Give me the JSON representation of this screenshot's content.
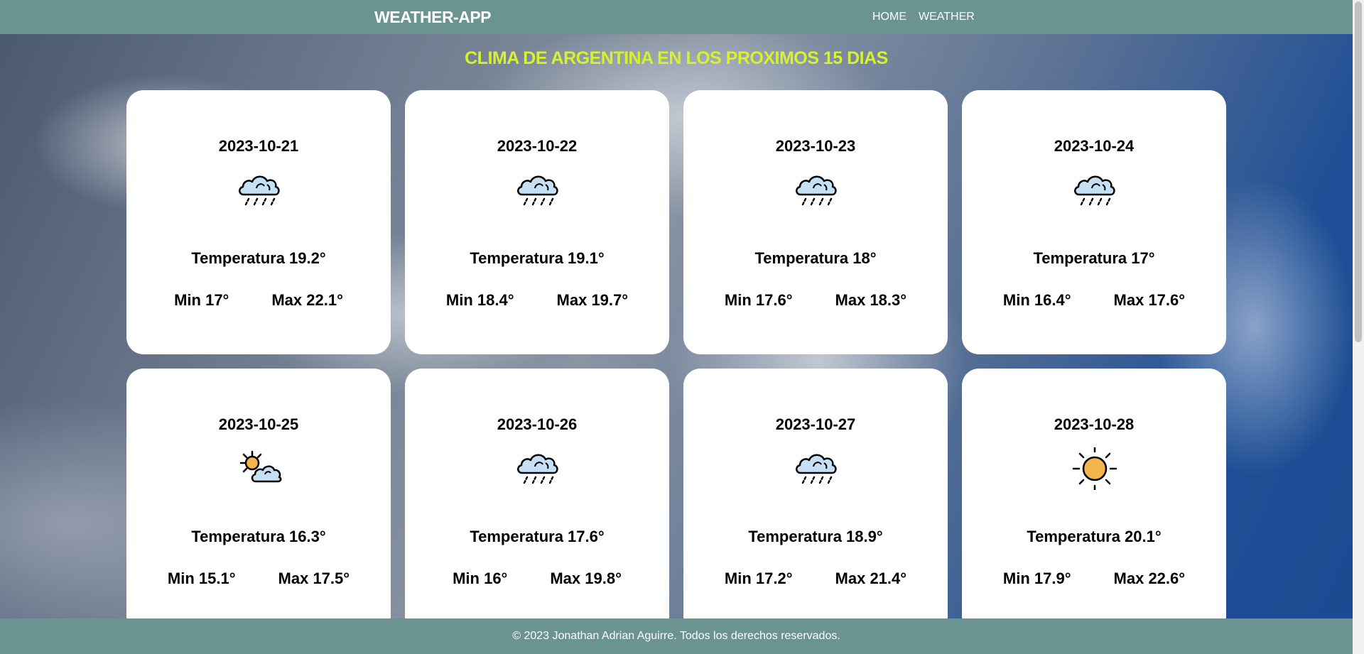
{
  "navbar": {
    "brand": "WEATHER-APP",
    "links": [
      {
        "label": "HOME"
      },
      {
        "label": "WEATHER"
      }
    ]
  },
  "heading": "CLIMA DE ARGENTINA EN LOS PROXIMOS 15 DIAS",
  "colors": {
    "navbar": "#6a9391",
    "heading": "#d6f22c",
    "card": "#ffffff",
    "sun": "#f4b54c",
    "cloud": "#c5e0f5"
  },
  "cards": [
    {
      "date": "2023-10-21",
      "icon": "rain-cloud-icon",
      "temp": "Temperatura 19.2°",
      "min": "Min 17°",
      "max": "Max 22.1°"
    },
    {
      "date": "2023-10-22",
      "icon": "rain-cloud-icon",
      "temp": "Temperatura 19.1°",
      "min": "Min 18.4°",
      "max": "Max 19.7°"
    },
    {
      "date": "2023-10-23",
      "icon": "rain-cloud-icon",
      "temp": "Temperatura 18°",
      "min": "Min 17.6°",
      "max": "Max 18.3°"
    },
    {
      "date": "2023-10-24",
      "icon": "rain-cloud-icon",
      "temp": "Temperatura 17°",
      "min": "Min 16.4°",
      "max": "Max 17.6°"
    },
    {
      "date": "2023-10-25",
      "icon": "partly-cloudy-icon",
      "temp": "Temperatura 16.3°",
      "min": "Min 15.1°",
      "max": "Max 17.5°"
    },
    {
      "date": "2023-10-26",
      "icon": "rain-cloud-icon",
      "temp": "Temperatura 17.6°",
      "min": "Min 16°",
      "max": "Max 19.8°"
    },
    {
      "date": "2023-10-27",
      "icon": "rain-cloud-icon",
      "temp": "Temperatura 18.9°",
      "min": "Min 17.2°",
      "max": "Max 21.4°"
    },
    {
      "date": "2023-10-28",
      "icon": "sun-icon",
      "temp": "Temperatura 20.1°",
      "min": "Min 17.9°",
      "max": "Max 22.6°"
    }
  ],
  "footer": "© 2023 Jonathan Adrian Aguirre. Todos los derechos reservados."
}
